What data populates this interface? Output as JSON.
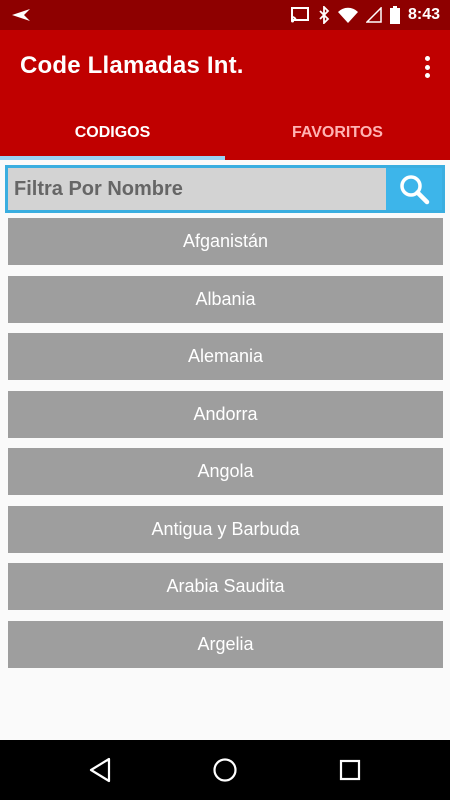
{
  "status_bar": {
    "time": "8:43",
    "icons": [
      "back-arrow-icon",
      "cast-icon",
      "bluetooth-icon",
      "wifi-icon",
      "signal-icon",
      "battery-icon"
    ]
  },
  "app_bar": {
    "title": "Code Llamadas Int.",
    "menu_icon": "more-vert-icon"
  },
  "tabs": [
    {
      "label": "CODIGOS",
      "active": true
    },
    {
      "label": "FAVORITOS",
      "active": false
    }
  ],
  "search": {
    "placeholder": "Filtra Por Nombre",
    "value": "",
    "icon": "search-icon"
  },
  "countries": [
    "Afganistán",
    "Albania",
    "Alemania",
    "Andorra",
    "Angola",
    "Antigua y Barbuda",
    "Arabia Saudita",
    "Argelia"
  ],
  "colors": {
    "status_bar": "#8e0000",
    "app_bar": "#c00000",
    "tab_indicator": "#9ad3f5",
    "search_accent": "#3db5ea",
    "list_item": "#9e9e9e"
  },
  "nav_bar": {
    "icons": [
      "back-icon",
      "home-icon",
      "recents-icon"
    ]
  }
}
